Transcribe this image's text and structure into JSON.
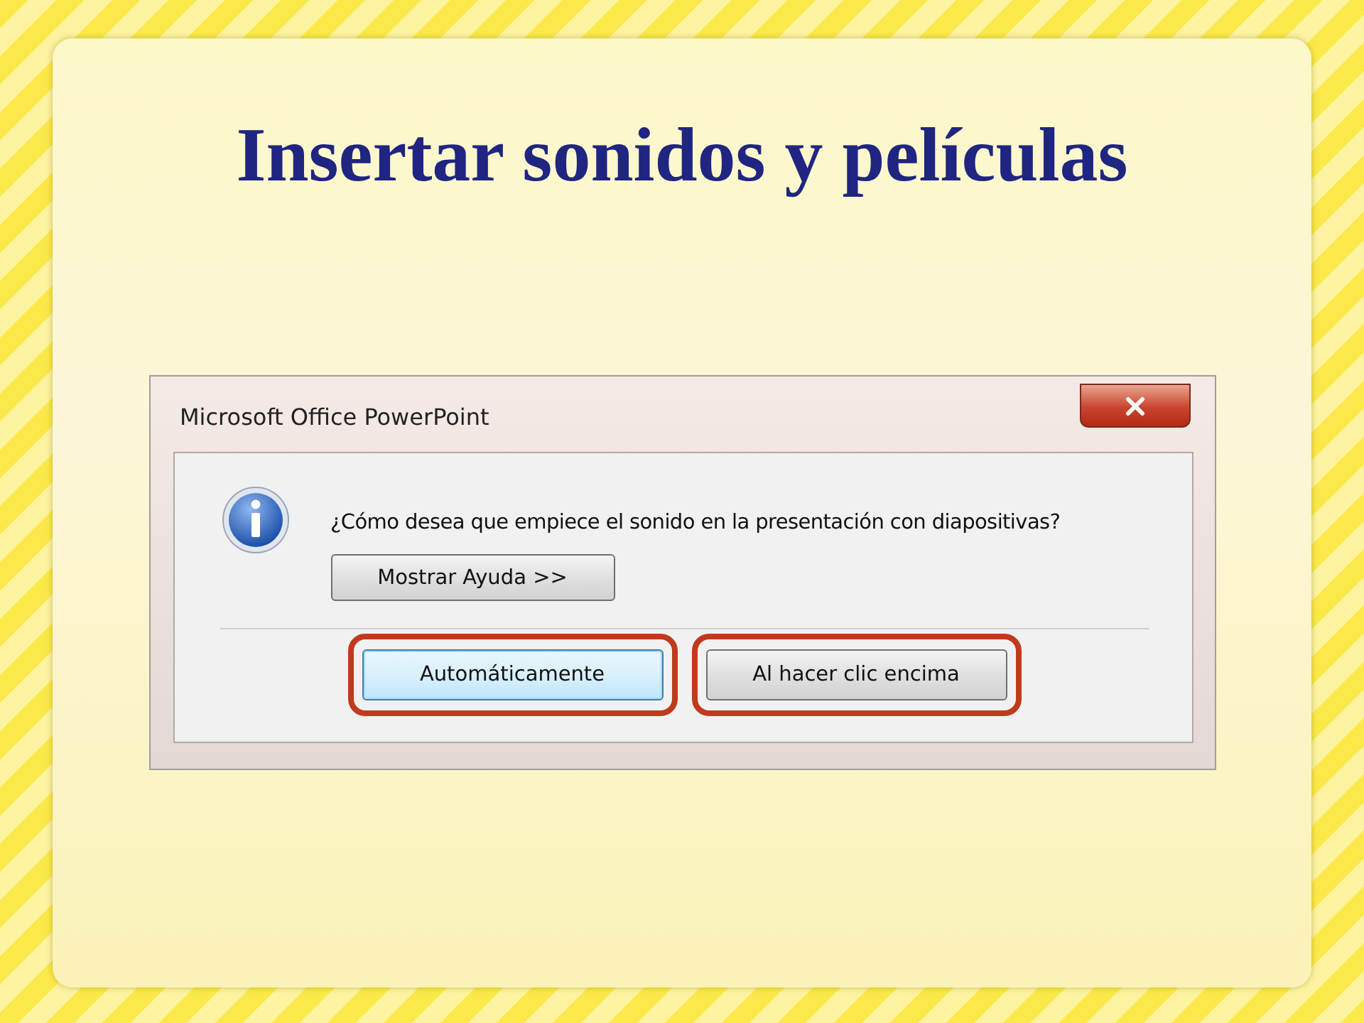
{
  "slide": {
    "title": "Insertar sonidos y películas"
  },
  "dialog": {
    "title": "Microsoft Office PowerPoint",
    "message": "¿Cómo desea que empiece el sonido en la presentación con diapositivas?",
    "help_button": "Mostrar Ayuda >>",
    "buttons": [
      {
        "label": "Automáticamente",
        "focused": true,
        "highlighted": true
      },
      {
        "label": "Al hacer clic encima",
        "focused": false,
        "highlighted": true
      }
    ]
  }
}
